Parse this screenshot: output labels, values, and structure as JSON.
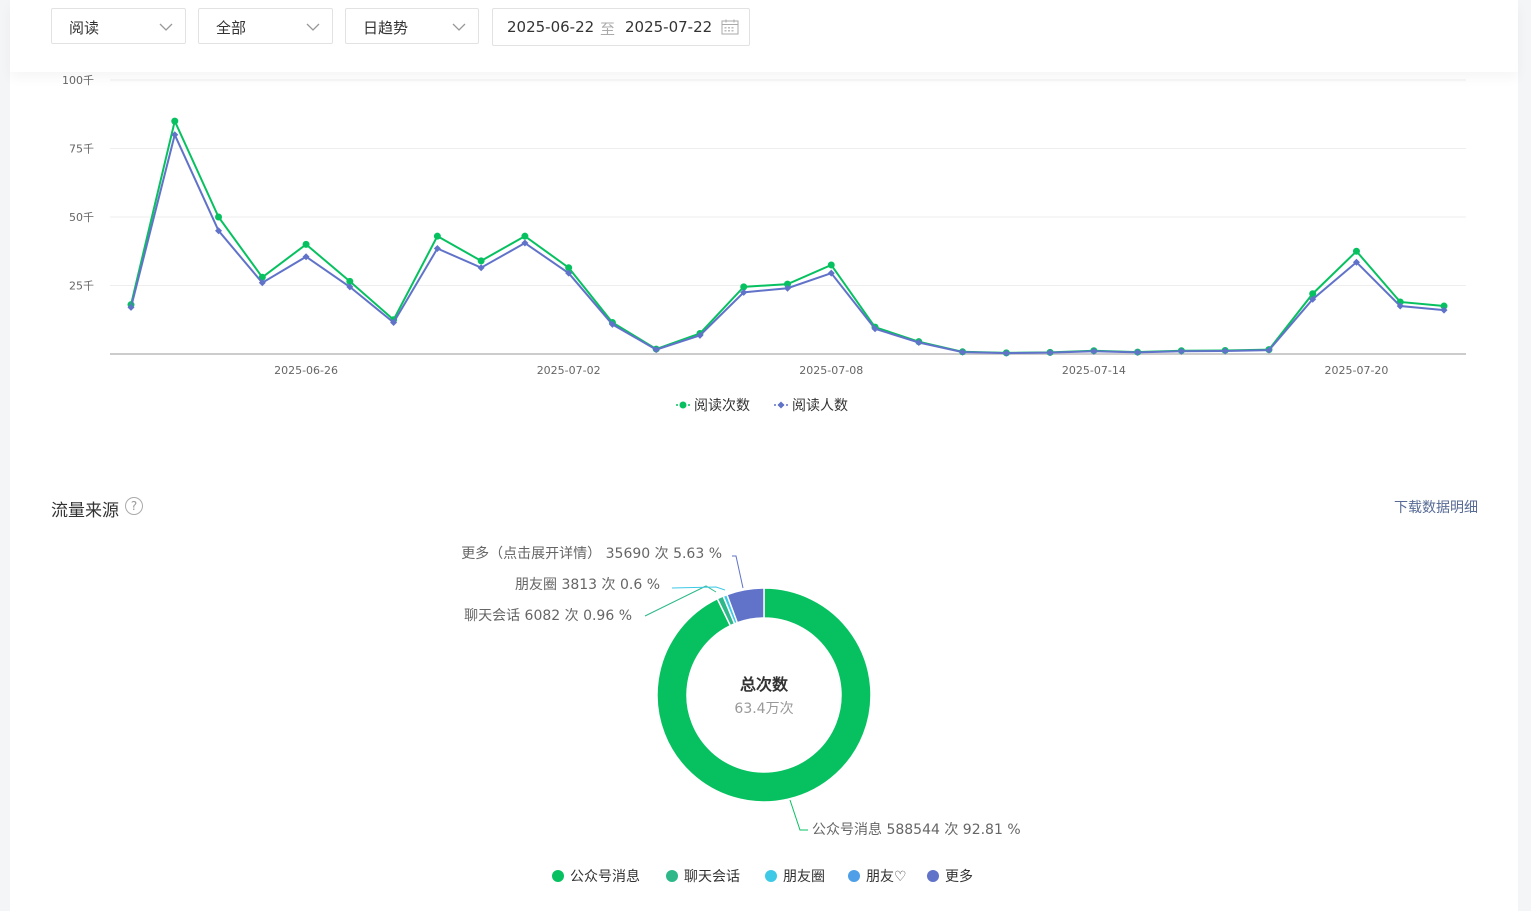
{
  "filters": {
    "metric": "阅读",
    "scope": "全部",
    "trend": "日趋势",
    "date_start": "2025-06-22",
    "date_sep": "至",
    "date_end": "2025-07-22"
  },
  "trend_chart": {
    "yticks": [
      "100千",
      "75千",
      "50千",
      "25千"
    ],
    "xticks": [
      "2025-06-26",
      "2025-07-02",
      "2025-07-08",
      "2025-07-14",
      "2025-07-20"
    ]
  },
  "traffic": {
    "title": "流量来源",
    "help": "?",
    "download": "下载数据明细",
    "center_title": "总次数",
    "center_value": "63.4万次",
    "labels": {
      "more": "更多（点击展开详情） 35690 次 5.63 %",
      "moments": "朋友圈 3813 次 0.6 %",
      "chat": "聊天会话 6082 次 0.96 %",
      "official": "公众号消息 588544 次 92.81 %"
    },
    "legend": [
      "公众号消息",
      "聊天会话",
      "朋友圈",
      "朋友♡",
      "更多"
    ]
  },
  "colors": {
    "green": "#07c160",
    "purple": "#6173c9",
    "teal": "#2eb88a",
    "cyan": "#3ec9e6",
    "blue": "#4e9fe8"
  },
  "chart_data": [
    {
      "type": "line",
      "x": [
        "2025-06-22",
        "2025-06-23",
        "2025-06-24",
        "2025-06-25",
        "2025-06-26",
        "2025-06-27",
        "2025-06-28",
        "2025-06-29",
        "2025-06-30",
        "2025-07-01",
        "2025-07-02",
        "2025-07-03",
        "2025-07-04",
        "2025-07-05",
        "2025-07-06",
        "2025-07-07",
        "2025-07-08",
        "2025-07-09",
        "2025-07-10",
        "2025-07-11",
        "2025-07-12",
        "2025-07-13",
        "2025-07-14",
        "2025-07-15",
        "2025-07-16",
        "2025-07-17",
        "2025-07-18",
        "2025-07-19",
        "2025-07-20",
        "2025-07-21",
        "2025-07-22"
      ],
      "series": [
        {
          "name": "阅读次数",
          "color": "#07c160",
          "marker": "circle",
          "values": [
            18000,
            85000,
            50000,
            28000,
            40000,
            26500,
            12500,
            43000,
            34000,
            43000,
            31500,
            11500,
            1800,
            7500,
            24500,
            25500,
            32500,
            9800,
            4500,
            800,
            400,
            600,
            1200,
            700,
            1200,
            1300,
            1600,
            22000,
            37500,
            19000,
            17500
          ]
        },
        {
          "name": "阅读人数",
          "color": "#6173c9",
          "marker": "diamond",
          "values": [
            17000,
            80000,
            45000,
            26000,
            35500,
            24500,
            11500,
            38500,
            31500,
            40500,
            29500,
            10800,
            1600,
            6800,
            22500,
            24000,
            29500,
            9200,
            4200,
            700,
            300,
            500,
            1000,
            600,
            1000,
            1100,
            1400,
            20000,
            33500,
            17500,
            16000
          ]
        }
      ],
      "ylim": [
        0,
        100000
      ],
      "yticks": [
        "100千",
        "75千",
        "50千",
        "25千"
      ],
      "legend": "bottom-center",
      "grid": true
    },
    {
      "type": "pie",
      "title": "总次数",
      "slices": [
        {
          "name": "公众号消息",
          "value": 588544,
          "percent": 92.81,
          "color": "#07c160"
        },
        {
          "name": "聊天会话",
          "value": 6082,
          "percent": 0.96,
          "color": "#2eb88a"
        },
        {
          "name": "朋友圈",
          "value": 3813,
          "percent": 0.6,
          "color": "#3ec9e6"
        },
        {
          "name": "朋友♡",
          "value": 0,
          "percent": 0,
          "color": "#4e9fe8"
        },
        {
          "name": "更多",
          "value": 35690,
          "percent": 5.63,
          "color": "#6173c9"
        }
      ]
    }
  ]
}
